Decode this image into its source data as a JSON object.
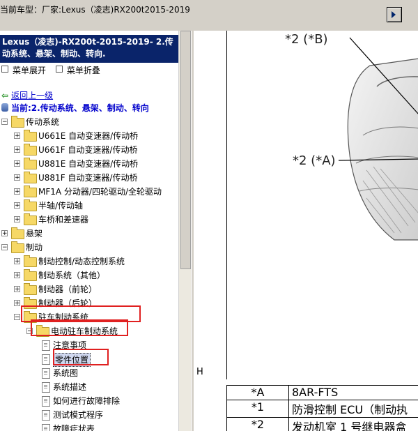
{
  "topbar": {
    "title": "当前车型：厂家:Lexus（凌志)RX200t2015-2019"
  },
  "left": {
    "header": "Lexus（凌志)-RX200t-2015-2019- 2.传动系统、悬架、制动、转向.",
    "menu_expand": "菜单展开",
    "menu_collapse": "菜单折叠",
    "back_link": "返回上一级",
    "current": "当前:2.传动系统、悬架、制动、转向",
    "tree": [
      {
        "label": "传动系统",
        "level": 0,
        "type": "folder",
        "expanded": true
      },
      {
        "label": "U661E 自动变速器/传动桥",
        "level": 1,
        "type": "folder"
      },
      {
        "label": "U661F 自动变速器/传动桥",
        "level": 1,
        "type": "folder"
      },
      {
        "label": "U881E 自动变速器/传动桥",
        "level": 1,
        "type": "folder"
      },
      {
        "label": "U881F 自动变速器/传动桥",
        "level": 1,
        "type": "folder"
      },
      {
        "label": "MF1A 分动器/四轮驱动/全轮驱动",
        "level": 1,
        "type": "folder"
      },
      {
        "label": "半轴/传动轴",
        "level": 1,
        "type": "folder"
      },
      {
        "label": "车桥和差速器",
        "level": 1,
        "type": "folder"
      },
      {
        "label": "悬架",
        "level": 0,
        "type": "folder"
      },
      {
        "label": "制动",
        "level": 0,
        "type": "folder",
        "expanded": true
      },
      {
        "label": "制动控制/动态控制系统",
        "level": 1,
        "type": "folder"
      },
      {
        "label": "制动系统（其他）",
        "level": 1,
        "type": "folder"
      },
      {
        "label": "制动器（前轮）",
        "level": 1,
        "type": "folder"
      },
      {
        "label": "制动器（后轮）",
        "level": 1,
        "type": "folder"
      },
      {
        "label": "驻车制动系统",
        "level": 1,
        "type": "folder",
        "expanded": true
      },
      {
        "label": "电动驻车制动系统",
        "level": 2,
        "type": "folder",
        "expanded": true
      },
      {
        "label": "注意事项",
        "level": 3,
        "type": "doc"
      },
      {
        "label": "零件位置",
        "level": 3,
        "type": "doc",
        "selected": true
      },
      {
        "label": "系统图",
        "level": 3,
        "type": "doc"
      },
      {
        "label": "系统描述",
        "level": 3,
        "type": "doc"
      },
      {
        "label": "如何进行故障排除",
        "level": 3,
        "type": "doc"
      },
      {
        "label": "测试模式程序",
        "level": 3,
        "type": "doc"
      },
      {
        "label": "故障症状表",
        "level": 3,
        "type": "doc"
      }
    ]
  },
  "figure": {
    "callouts": [
      "*2 (*B)",
      "*2 (*A)"
    ],
    "corner_label": "H"
  },
  "parts_table": [
    [
      "*A",
      "8AR-FTS"
    ],
    [
      "*1",
      "防滑控制 ECU（制动执"
    ],
    [
      "*2",
      "发动机室 1 号继电器盒"
    ]
  ],
  "colors": {
    "highlight_box": "#e02020",
    "header_bg": "#0a246a"
  }
}
